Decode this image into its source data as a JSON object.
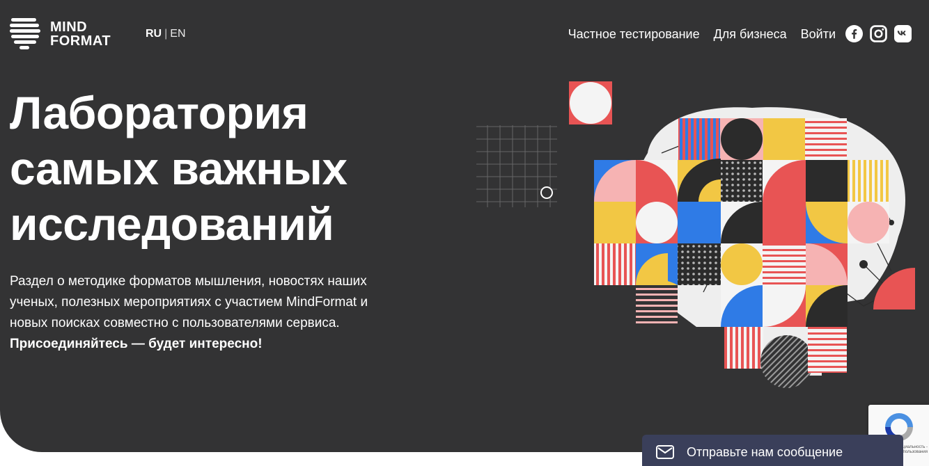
{
  "brand": {
    "logo_line1": "MIND",
    "logo_line2": "FORMAT"
  },
  "lang": {
    "ru": "RU",
    "separator": "|",
    "en": "EN"
  },
  "nav": {
    "items": [
      "Частное тестирование",
      "Для бизнеса",
      "Войти"
    ]
  },
  "socials": [
    "facebook-icon",
    "instagram-icon",
    "vk-icon"
  ],
  "hero": {
    "title_lines": [
      "Лаборатория",
      "самых важных",
      "исследований"
    ],
    "description": "Раздел о методике форматов мышления, новостях наших ученых, полезных мероприятиях с участием MindFormat и новых поисках совместно с пользователями сервиса. ",
    "description_bold": "Присоединяйтесь — будет интересно!"
  },
  "chat": {
    "label": "Отправьте нам сообщение"
  },
  "recaptcha": {
    "text": "Конфиденциальность - Условия использования"
  },
  "colors": {
    "background": "#333334",
    "red": "#e85454",
    "yellow": "#f2c744",
    "blue": "#2f7be6",
    "pink": "#f6b3b3",
    "white": "#f4f4f4",
    "dark": "#2b2b2b"
  }
}
